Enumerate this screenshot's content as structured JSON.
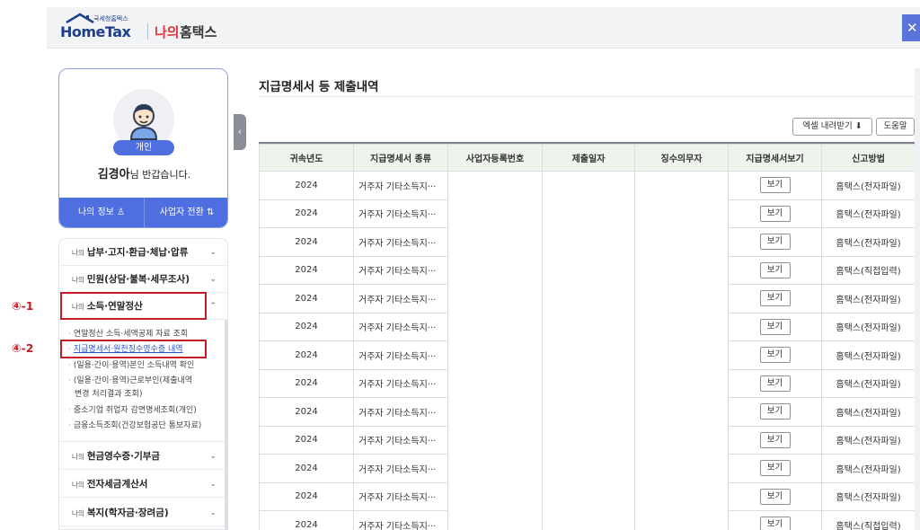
{
  "header": {
    "logo_small": "국세청홈택스",
    "logo_main": "HomeTax",
    "logo_my": "나의",
    "logo_hometax": "홈택스",
    "close_label": "✕"
  },
  "profile": {
    "role": "개인",
    "name": "김경아",
    "greeting_suffix": "님 반갑습니다.",
    "my_info": "나의 정보 ♙",
    "switch_business": "사업자 전환 ⇅"
  },
  "menu": {
    "items": [
      {
        "prefix": "나의",
        "label": "납부·고지·환급·체납·압류",
        "chevron": "⌄"
      },
      {
        "prefix": "나의",
        "label": "민원(상담·불복·세무조사)",
        "chevron": "⌄"
      },
      {
        "prefix": "나의",
        "label": "소득·연말정산",
        "chevron": "⌃"
      },
      {
        "prefix": "나의",
        "label": "현금영수증·기부금",
        "chevron": "⌄"
      },
      {
        "prefix": "나의",
        "label": "전자세금계산서",
        "chevron": "⌄"
      },
      {
        "prefix": "나의",
        "label": "복지(학자금·장려금)",
        "chevron": "⌄"
      }
    ],
    "sub_items": [
      "연말정산 소득·세액공제 자료 조회",
      "지급명세서·원천징수영수증 내역",
      "(일용·간이·용역)본인 소득내역 확인",
      "(일용·간이·용역)근로부인(제출내역",
      "변경 처리결과 조회)",
      "중소기업 취업자 감면명세조회(개인)",
      "금융소득조회(건강보험공단 통보자료)"
    ],
    "step_labels": [
      "④-1",
      "④-2"
    ],
    "collapse_icon": "‹"
  },
  "main": {
    "title": "지급명세서 등 제출내역",
    "excel_button": "엑셀 내려받기 ⬇",
    "help_button": "도움말",
    "columns": [
      "귀속년도",
      "지급명세서 종류",
      "사업자등록번호",
      "제출일자",
      "징수의무자",
      "지급명세서보기",
      "신고방법"
    ],
    "view_label": "보기",
    "rows": [
      {
        "year": "2024",
        "type": "거주자 기타소득지···",
        "method": "홈택스(전자파일)"
      },
      {
        "year": "2024",
        "type": "거주자 기타소득지···",
        "method": "홈택스(전자파일)"
      },
      {
        "year": "2024",
        "type": "거주자 기타소득지···",
        "method": "홈택스(전자파일)"
      },
      {
        "year": "2024",
        "type": "거주자 기타소득지···",
        "method": "홈택스(직접입력)"
      },
      {
        "year": "2024",
        "type": "거주자 기타소득지···",
        "method": "홈택스(전자파일)"
      },
      {
        "year": "2024",
        "type": "거주자 기타소득지···",
        "method": "홈택스(전자파일)"
      },
      {
        "year": "2024",
        "type": "거주자 기타소득지···",
        "method": "홈택스(전자파일)"
      },
      {
        "year": "2024",
        "type": "거주자 기타소득지···",
        "method": "홈택스(전자파일)"
      },
      {
        "year": "2024",
        "type": "거주자 기타소득지···",
        "method": "홈택스(전자파일)"
      },
      {
        "year": "2024",
        "type": "거주자 기타소득지···",
        "method": "홈택스(전자파일)"
      },
      {
        "year": "2024",
        "type": "거주자 기타소득지···",
        "method": "홈택스(전자파일)"
      },
      {
        "year": "2024",
        "type": "거주자 기타소득지···",
        "method": "홈택스(전자파일)"
      },
      {
        "year": "2024",
        "type": "거주자 기타소득지···",
        "method": "홈택스(직접입력)"
      }
    ]
  }
}
